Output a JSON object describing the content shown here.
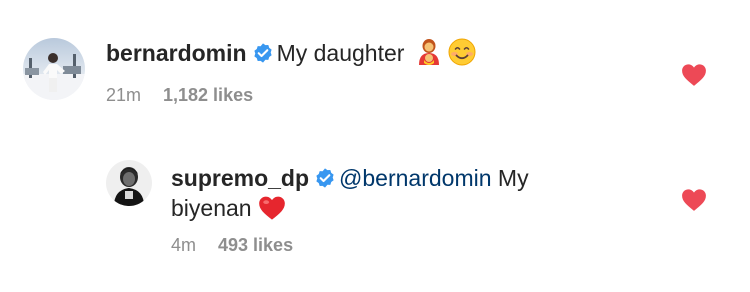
{
  "comments": [
    {
      "username": "bernardomin",
      "text": "My daughter",
      "time": "21m",
      "likes": "1,182 likes",
      "emoji": [
        "woman-with-baby-icon",
        "smiling-face-icon"
      ],
      "liked": true
    },
    {
      "username": "supremo_dp",
      "mention": "@bernardomin",
      "text_line1": "My",
      "text_line2": "biyenan",
      "time": "4m",
      "likes": "493 likes",
      "emoji": [
        "red-heart-icon"
      ],
      "liked": true
    }
  ],
  "colors": {
    "text": "#262626",
    "meta": "#8e8e8e",
    "mention": "#00376b",
    "verified": "#3897f0",
    "heart": "#ed4956"
  }
}
